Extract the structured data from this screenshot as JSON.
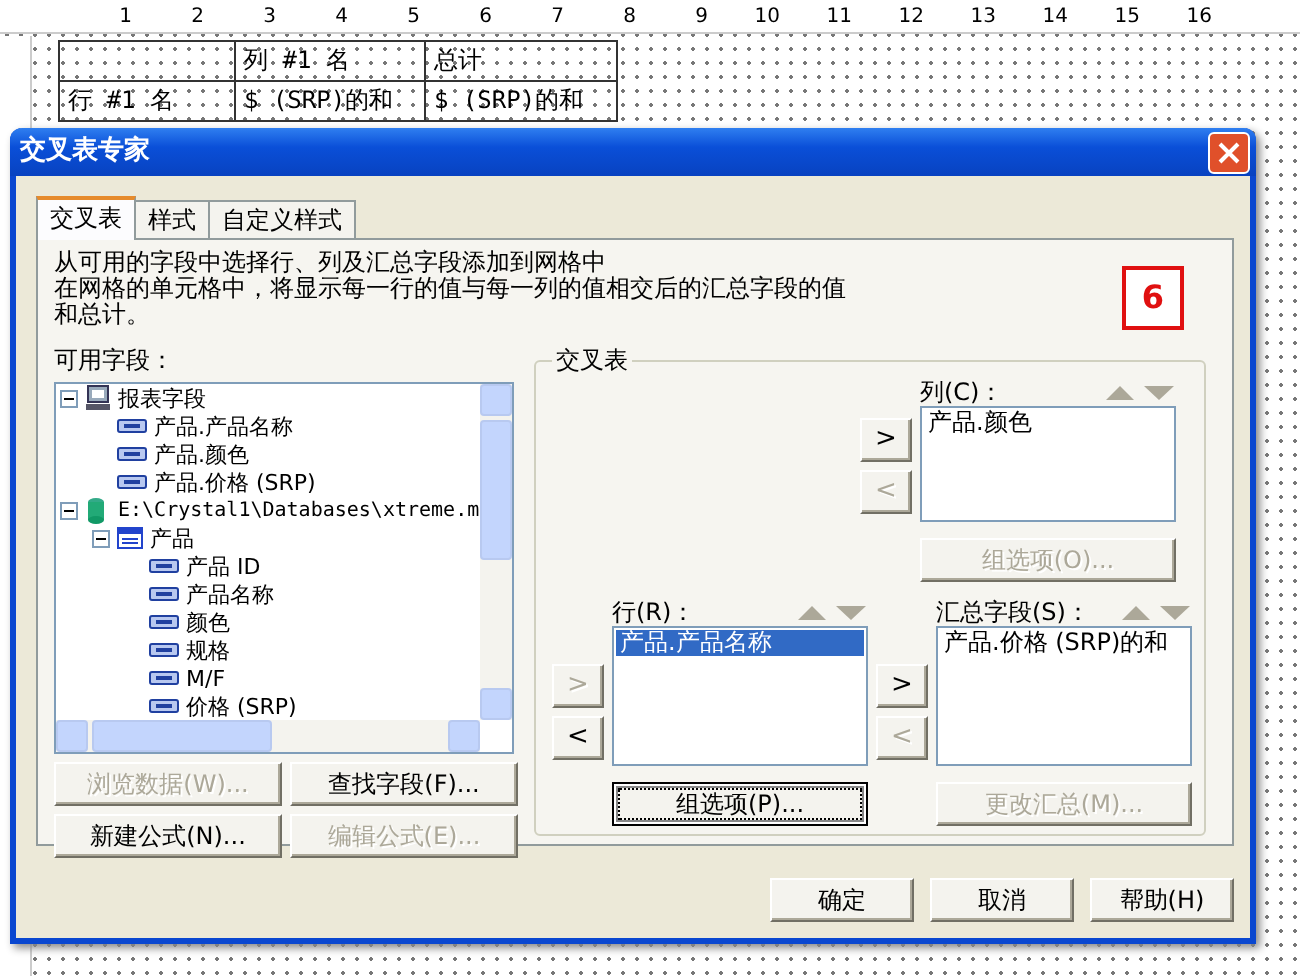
{
  "designer": {
    "ruler_numbers": [
      "1",
      "2",
      "3",
      "4",
      "5",
      "6",
      "7",
      "8",
      "9",
      "10",
      "11",
      "12",
      "13",
      "14",
      "15",
      "16"
    ],
    "column_headers": [
      "列 #1 名",
      "总计"
    ],
    "rows": [
      {
        "label": "行 #1 名",
        "cells": [
          "$ (SRP)的和",
          "$ (SRP)的和"
        ]
      }
    ]
  },
  "dialog": {
    "title": "交叉表专家",
    "tabs": [
      {
        "label": "交叉表",
        "selected": true
      },
      {
        "label": "样式",
        "selected": false
      },
      {
        "label": "自定义样式",
        "selected": false
      }
    ],
    "description": [
      "从可用的字段中选择行、列及汇总字段添加到网格中",
      "在网格的单元格中，将显示每一行的值与每一列的值相交后的汇总字段的值和总计。"
    ],
    "step_badge": "6",
    "available_fields": {
      "label": "可用字段：",
      "tree": [
        {
          "kind": "group",
          "text": "报表字段",
          "expanded": true,
          "children": [
            {
              "kind": "field",
              "text": "产品.产品名称"
            },
            {
              "kind": "field",
              "text": "产品.颜色"
            },
            {
              "kind": "field",
              "text": "产品.价格 (SRP)"
            }
          ]
        },
        {
          "kind": "database",
          "text": "E:\\Crystal1\\Databases\\xtreme.m",
          "expanded": true,
          "children": [
            {
              "kind": "table",
              "text": "产品",
              "expanded": true,
              "children": [
                {
                  "kind": "field",
                  "text": "产品 ID"
                },
                {
                  "kind": "field",
                  "text": "产品名称"
                },
                {
                  "kind": "field",
                  "text": "颜色"
                },
                {
                  "kind": "field",
                  "text": "规格"
                },
                {
                  "kind": "field",
                  "text": "M/F"
                },
                {
                  "kind": "field",
                  "text": "价格 (SRP)"
                }
              ]
            }
          ]
        }
      ],
      "buttons": [
        {
          "label": "浏览数据(W)...",
          "disabled": true,
          "focused": false
        },
        {
          "label": "查找字段(F)...",
          "disabled": false,
          "focused": false
        },
        {
          "label": "新建公式(N)...",
          "disabled": false,
          "focused": false
        },
        {
          "label": "编辑公式(E)...",
          "disabled": true,
          "focused": false
        }
      ]
    },
    "crosstab": {
      "title": "交叉表",
      "columns": {
        "label": "列(C)：",
        "add": {
          "label": ">",
          "disabled": false
        },
        "remove": {
          "label": "<",
          "disabled": true
        },
        "items": [
          {
            "text": "产品.颜色",
            "selected": false
          }
        ],
        "button": {
          "label": "组选项(O)...",
          "disabled": true,
          "focused": false
        }
      },
      "rows": {
        "label": "行(R)：",
        "add": {
          "label": ">",
          "disabled": true
        },
        "remove": {
          "label": "<",
          "disabled": false
        },
        "items": [
          {
            "text": "产品.产品名称",
            "selected": true
          }
        ],
        "button": {
          "label": "组选项(P)...",
          "disabled": false,
          "focused": true
        }
      },
      "summary": {
        "label": "汇总字段(S)：",
        "add": {
          "label": ">",
          "disabled": false
        },
        "remove": {
          "label": "<",
          "disabled": true
        },
        "items": [
          {
            "text": "产品.价格 (SRP)的和",
            "selected": false
          }
        ],
        "button": {
          "label": "更改汇总(M)...",
          "disabled": true,
          "focused": false
        }
      }
    },
    "footer_buttons": [
      {
        "label": "确定",
        "disabled": false,
        "focused": false
      },
      {
        "label": "取消",
        "disabled": false,
        "focused": false
      },
      {
        "label": "帮助(H)",
        "disabled": false,
        "focused": false
      }
    ]
  }
}
